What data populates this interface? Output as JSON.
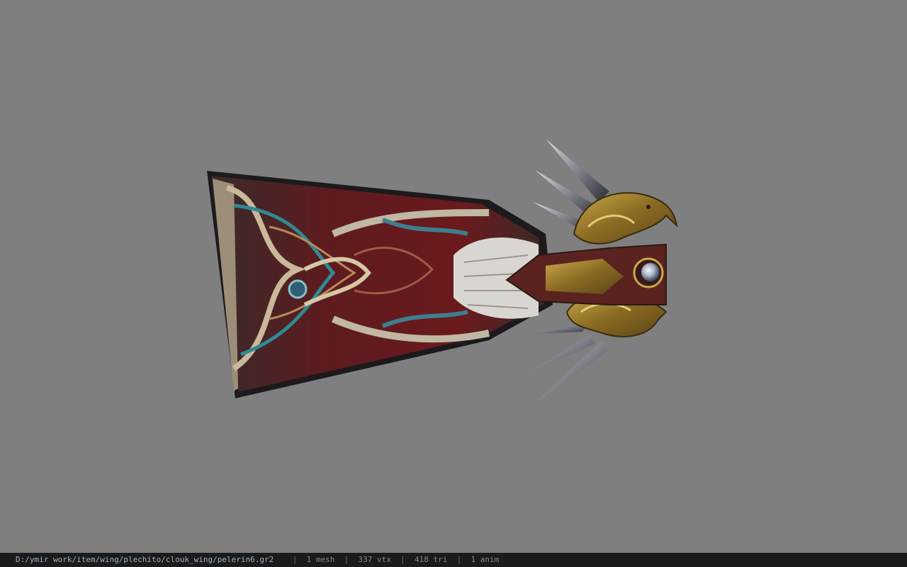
{
  "viewport": {
    "background": "#7f7f7f",
    "model_name": "pelerin6",
    "model_icon": "cloak-wing-model"
  },
  "status": {
    "path": "D:/ymir work/item/wing/plechito/clouk_wing/pelerin6.gr2",
    "mesh": "1 mesh",
    "vtx": "337 vtx",
    "tri": "418 tri",
    "anim": "1 anim",
    "separator": "|"
  }
}
